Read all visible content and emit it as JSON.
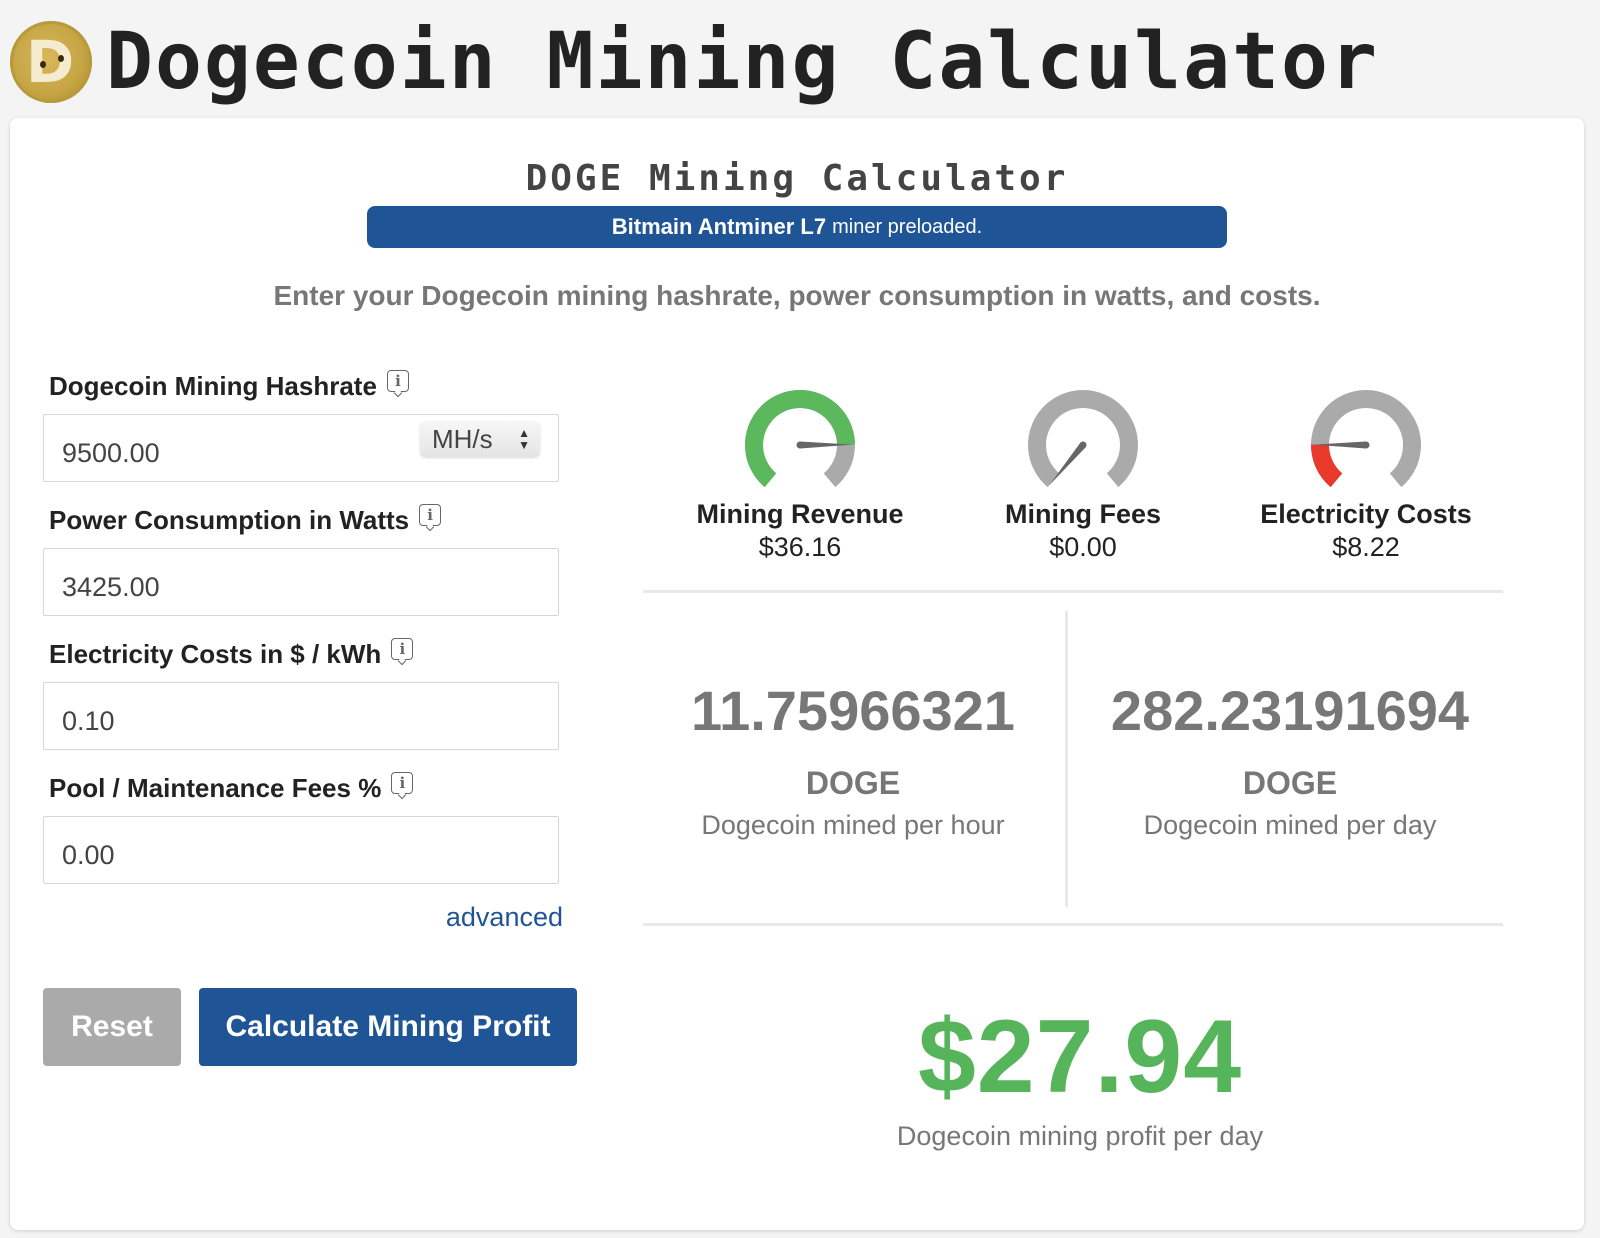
{
  "header": {
    "title": "Dogecoin Mining Calculator",
    "logo_icon": "dogecoin-logo",
    "logo_letter": "D"
  },
  "calculator": {
    "title": "DOGE Mining Calculator",
    "banner": {
      "miner_name": "Bitmain Antminer L7",
      "suffix": "miner preloaded."
    },
    "intro": "Enter your Dogecoin mining hashrate, power consumption in watts, and costs."
  },
  "form": {
    "fields": [
      {
        "label": "Dogecoin Mining Hashrate",
        "value": "9500.00",
        "unit": "MH/s",
        "info_icon": "info-icon"
      },
      {
        "label": "Power Consumption in Watts",
        "value": "3425.00",
        "info_icon": "info-icon"
      },
      {
        "label": "Electricity Costs in $ / kWh",
        "value": "0.10",
        "info_icon": "info-icon"
      },
      {
        "label": "Pool / Maintenance Fees %",
        "value": "0.00",
        "info_icon": "info-icon"
      }
    ],
    "advanced_link": "advanced",
    "reset_label": "Reset",
    "calculate_label": "Calculate Mining Profit"
  },
  "results": {
    "gauges": [
      {
        "label": "Mining Revenue",
        "value": "$36.16",
        "fill_fraction": 0.82,
        "color": "#5cb85c"
      },
      {
        "label": "Mining Fees",
        "value": "$0.00",
        "fill_fraction": 0.0,
        "color": "#5cb85c"
      },
      {
        "label": "Electricity Costs",
        "value": "$8.22",
        "fill_fraction": 0.18,
        "color": "#e8392a"
      }
    ],
    "per_hour": {
      "value": "11.75966321",
      "unit": "DOGE",
      "desc": "Dogecoin mined per hour"
    },
    "per_day": {
      "value": "282.23191694",
      "unit": "DOGE",
      "desc": "Dogecoin mined per day"
    },
    "profit": {
      "value": "$27.94",
      "desc": "Dogecoin mining profit per day",
      "color": "#56b55b"
    }
  },
  "colors": {
    "brand_blue": "#1f5596",
    "gauge_track": "#aaaaaa",
    "needle": "#666666"
  }
}
